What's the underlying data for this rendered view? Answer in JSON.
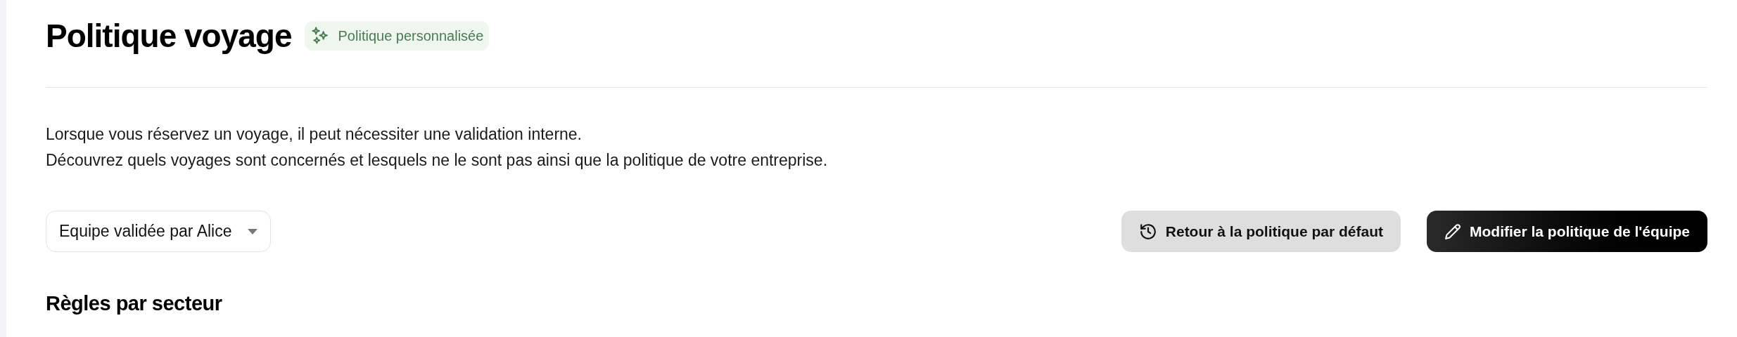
{
  "header": {
    "title": "Politique voyage",
    "badge": "Politique personnalisée"
  },
  "description": [
    "Lorsque vous réservez un voyage, il peut nécessiter une validation interne.",
    "Découvrez quels voyages sont concernés et lesquels ne le sont pas ainsi que la politique de votre entreprise."
  ],
  "team_select": {
    "value": "Equipe validée par Alice"
  },
  "buttons": [
    {
      "kind": "secondary",
      "label": "Retour à la politique par défaut"
    },
    {
      "kind": "primary",
      "label": "Modifier la politique de l'équipe"
    }
  ],
  "section_title": "Règles par secteur"
}
